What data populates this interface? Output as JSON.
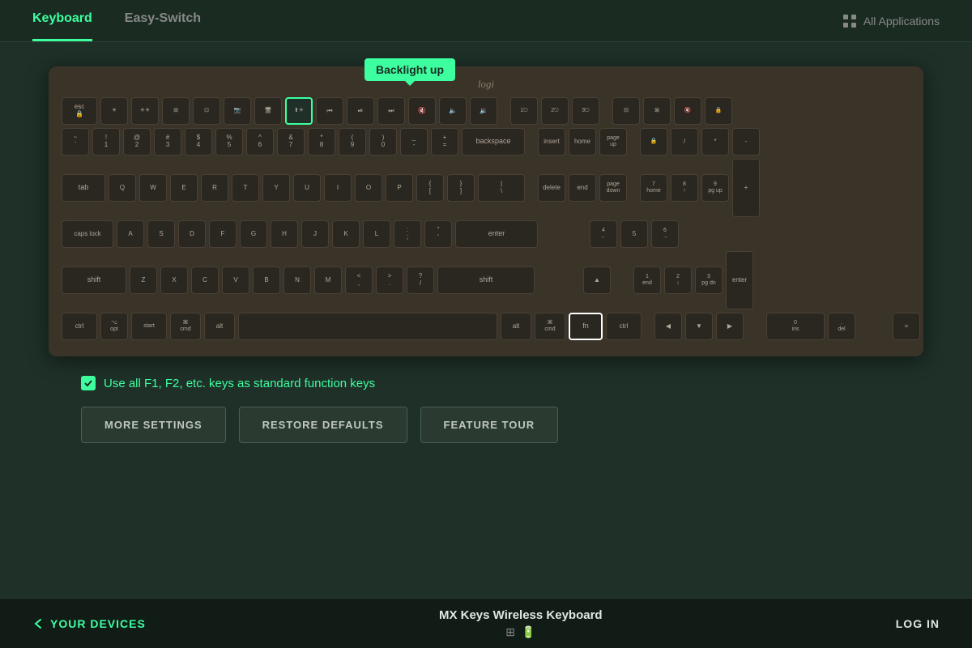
{
  "nav": {
    "tab_keyboard": "Keyboard",
    "tab_easyswitch": "Easy-Switch",
    "all_applications": "All Applications"
  },
  "keyboard": {
    "brand": "logi",
    "tooltip": "Backlight up"
  },
  "checkbox": {
    "label": "Use all F1, F2, etc. keys as standard function keys"
  },
  "buttons": {
    "more_settings": "MORE SETTINGS",
    "restore_defaults": "RESTORE DEFAULTS",
    "feature_tour": "FEATURE TOUR"
  },
  "bottom": {
    "your_devices": "YOUR DEVICES",
    "device_name": "MX Keys Wireless Keyboard",
    "log_in": "LOG IN"
  },
  "colors": {
    "accent": "#3dffa0",
    "bg_dark": "#1a2c22",
    "bg_main": "#1e3028"
  }
}
